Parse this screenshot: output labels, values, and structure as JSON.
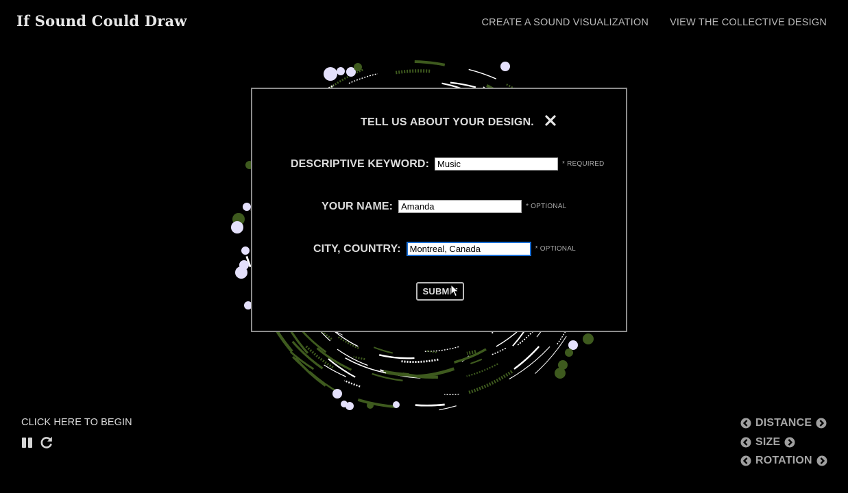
{
  "site": {
    "title": "If Sound Could Draw"
  },
  "nav": {
    "create_label": "CREATE A SOUND VISUALIZATION",
    "collective_label": "VIEW THE COLLECTIVE DESIGN"
  },
  "modal": {
    "title": "TELL US ABOUT YOUR DESIGN.",
    "close_icon": "close-icon",
    "fields": [
      {
        "label": "DESCRIPTIVE KEYWORD:",
        "value": "Music",
        "note": "* REQUIRED"
      },
      {
        "label": "YOUR NAME:",
        "value": "Amanda",
        "note": "* OPTIONAL"
      },
      {
        "label": "CITY, COUNTRY:",
        "value": "Montreal, Canada",
        "note": "* OPTIONAL"
      }
    ],
    "submit_label": "SUBMIT"
  },
  "player": {
    "begin_label": "CLICK HERE TO BEGIN",
    "pause_icon": "pause-icon",
    "replay_icon": "replay-icon"
  },
  "adjust": {
    "distance_label": "DISTANCE",
    "size_label": "SIZE",
    "rotation_label": "ROTATION"
  },
  "colors": {
    "background": "#000000",
    "accent_green": "#3e5a1e",
    "dot_lavender": "#e4e0fb"
  }
}
